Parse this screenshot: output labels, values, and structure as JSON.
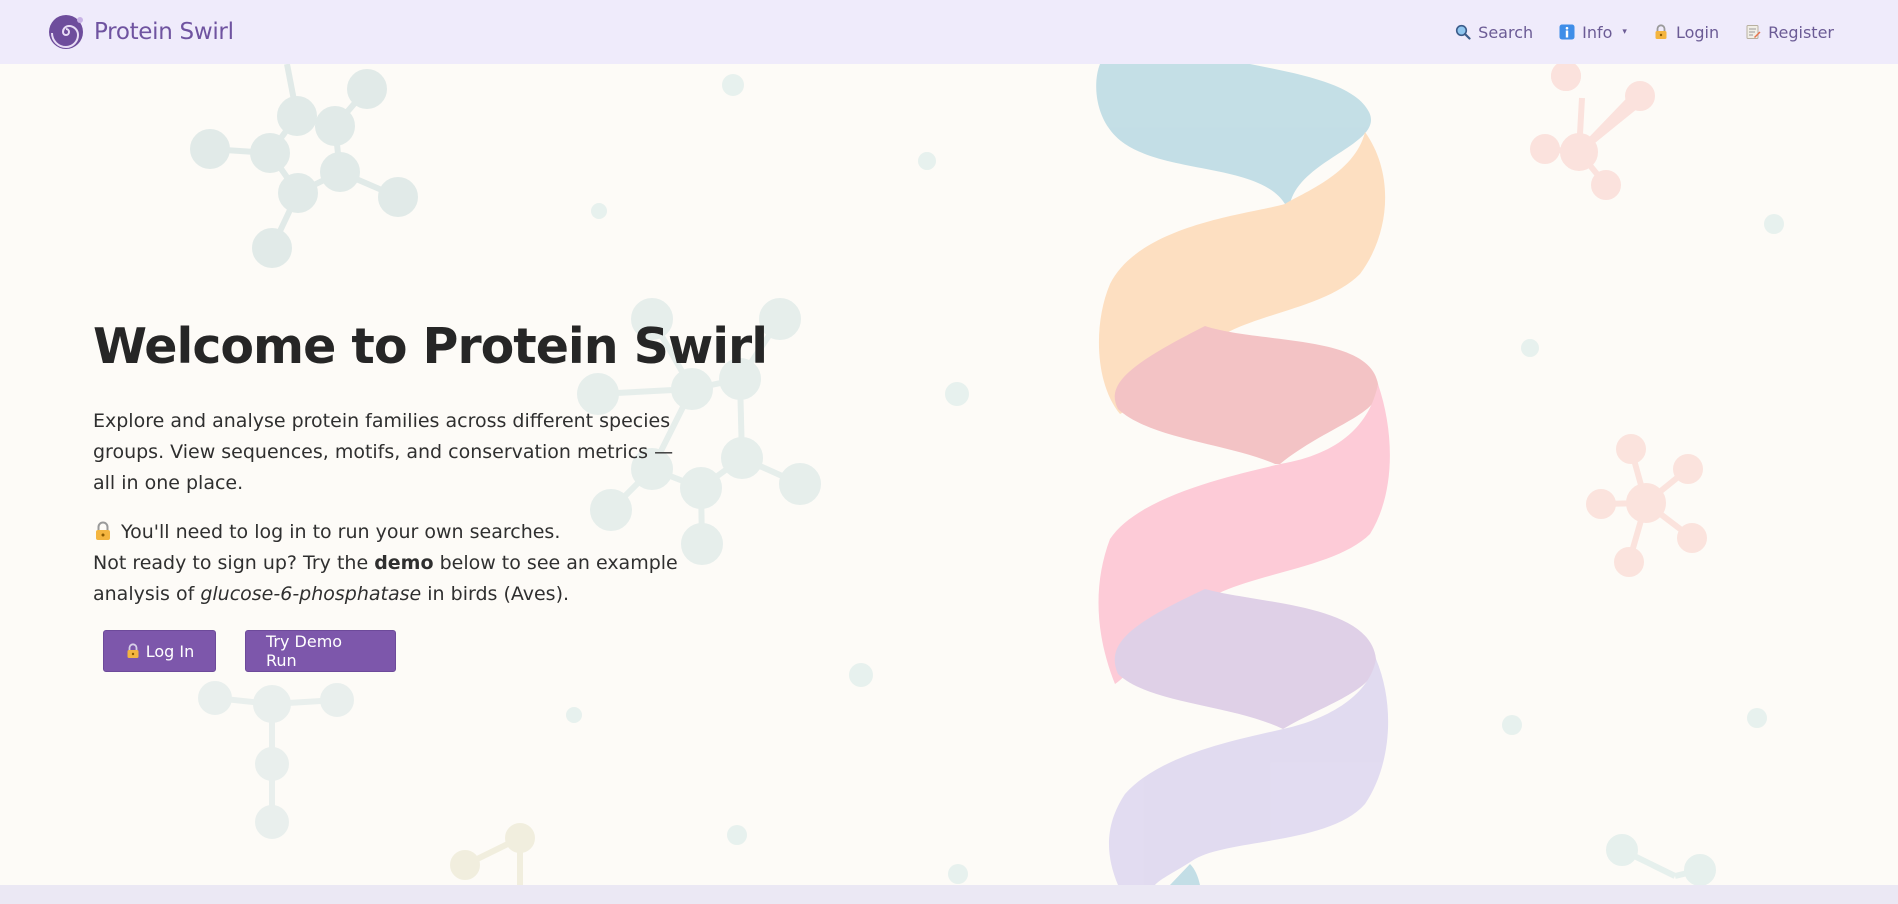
{
  "brand": {
    "name": "Protein Swirl",
    "logo_icon": "swirl-logo-icon"
  },
  "nav": {
    "search": {
      "label": "Search",
      "icon": "magnifier-icon"
    },
    "info": {
      "label": "Info",
      "icon": "info-icon",
      "caret": "▾"
    },
    "login": {
      "label": "Login",
      "icon": "lock-icon"
    },
    "register": {
      "label": "Register",
      "icon": "memo-icon"
    }
  },
  "hero": {
    "title": "Welcome to Protein Swirl",
    "description": "Explore and analyse protein families across different species groups. View sequences, motifs, and conservation metrics — all in one place.",
    "notice_line1": "You'll need to log in to run your own searches.",
    "notice_line2_pre": "Not ready to sign up? Try the ",
    "notice_demo": "demo",
    "notice_line2_mid": " below to see an example analysis of ",
    "notice_protein": "glucose-6-phosphatase",
    "notice_line2_post": " in birds (Aves).",
    "login_button": "Log In",
    "demo_button": "Try Demo Run"
  },
  "colors": {
    "brand": "#7d57ab",
    "nav_bg": "#efebfb",
    "page_bg": "#fdfbf7",
    "helix": [
      "#bcdbe4",
      "#fedcba",
      "#f2bcbf",
      "#fdc5d3",
      "#dccbe5",
      "#ded7f0"
    ]
  }
}
